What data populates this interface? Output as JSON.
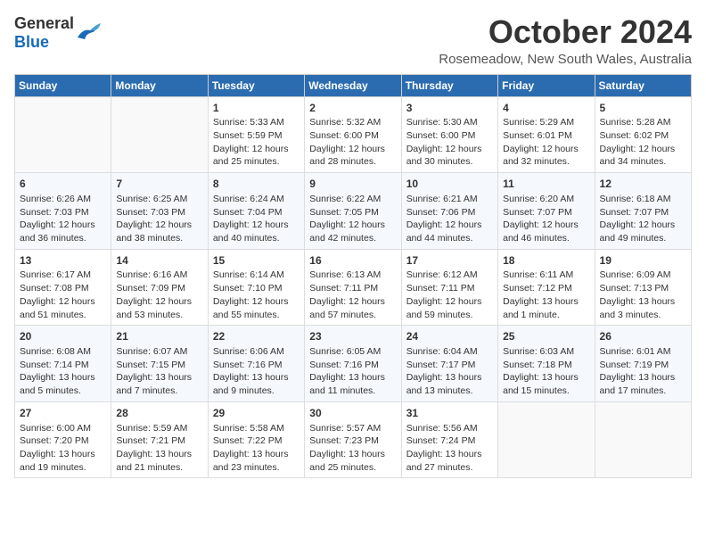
{
  "header": {
    "logo_general": "General",
    "logo_blue": "Blue",
    "month": "October 2024",
    "location": "Rosemeadow, New South Wales, Australia"
  },
  "days_of_week": [
    "Sunday",
    "Monday",
    "Tuesday",
    "Wednesday",
    "Thursday",
    "Friday",
    "Saturday"
  ],
  "weeks": [
    [
      {
        "day": "",
        "sunrise": "",
        "sunset": "",
        "daylight": ""
      },
      {
        "day": "",
        "sunrise": "",
        "sunset": "",
        "daylight": ""
      },
      {
        "day": "1",
        "sunrise": "Sunrise: 5:33 AM",
        "sunset": "Sunset: 5:59 PM",
        "daylight": "Daylight: 12 hours and 25 minutes."
      },
      {
        "day": "2",
        "sunrise": "Sunrise: 5:32 AM",
        "sunset": "Sunset: 6:00 PM",
        "daylight": "Daylight: 12 hours and 28 minutes."
      },
      {
        "day": "3",
        "sunrise": "Sunrise: 5:30 AM",
        "sunset": "Sunset: 6:00 PM",
        "daylight": "Daylight: 12 hours and 30 minutes."
      },
      {
        "day": "4",
        "sunrise": "Sunrise: 5:29 AM",
        "sunset": "Sunset: 6:01 PM",
        "daylight": "Daylight: 12 hours and 32 minutes."
      },
      {
        "day": "5",
        "sunrise": "Sunrise: 5:28 AM",
        "sunset": "Sunset: 6:02 PM",
        "daylight": "Daylight: 12 hours and 34 minutes."
      }
    ],
    [
      {
        "day": "6",
        "sunrise": "Sunrise: 6:26 AM",
        "sunset": "Sunset: 7:03 PM",
        "daylight": "Daylight: 12 hours and 36 minutes."
      },
      {
        "day": "7",
        "sunrise": "Sunrise: 6:25 AM",
        "sunset": "Sunset: 7:03 PM",
        "daylight": "Daylight: 12 hours and 38 minutes."
      },
      {
        "day": "8",
        "sunrise": "Sunrise: 6:24 AM",
        "sunset": "Sunset: 7:04 PM",
        "daylight": "Daylight: 12 hours and 40 minutes."
      },
      {
        "day": "9",
        "sunrise": "Sunrise: 6:22 AM",
        "sunset": "Sunset: 7:05 PM",
        "daylight": "Daylight: 12 hours and 42 minutes."
      },
      {
        "day": "10",
        "sunrise": "Sunrise: 6:21 AM",
        "sunset": "Sunset: 7:06 PM",
        "daylight": "Daylight: 12 hours and 44 minutes."
      },
      {
        "day": "11",
        "sunrise": "Sunrise: 6:20 AM",
        "sunset": "Sunset: 7:07 PM",
        "daylight": "Daylight: 12 hours and 46 minutes."
      },
      {
        "day": "12",
        "sunrise": "Sunrise: 6:18 AM",
        "sunset": "Sunset: 7:07 PM",
        "daylight": "Daylight: 12 hours and 49 minutes."
      }
    ],
    [
      {
        "day": "13",
        "sunrise": "Sunrise: 6:17 AM",
        "sunset": "Sunset: 7:08 PM",
        "daylight": "Daylight: 12 hours and 51 minutes."
      },
      {
        "day": "14",
        "sunrise": "Sunrise: 6:16 AM",
        "sunset": "Sunset: 7:09 PM",
        "daylight": "Daylight: 12 hours and 53 minutes."
      },
      {
        "day": "15",
        "sunrise": "Sunrise: 6:14 AM",
        "sunset": "Sunset: 7:10 PM",
        "daylight": "Daylight: 12 hours and 55 minutes."
      },
      {
        "day": "16",
        "sunrise": "Sunrise: 6:13 AM",
        "sunset": "Sunset: 7:11 PM",
        "daylight": "Daylight: 12 hours and 57 minutes."
      },
      {
        "day": "17",
        "sunrise": "Sunrise: 6:12 AM",
        "sunset": "Sunset: 7:11 PM",
        "daylight": "Daylight: 12 hours and 59 minutes."
      },
      {
        "day": "18",
        "sunrise": "Sunrise: 6:11 AM",
        "sunset": "Sunset: 7:12 PM",
        "daylight": "Daylight: 13 hours and 1 minute."
      },
      {
        "day": "19",
        "sunrise": "Sunrise: 6:09 AM",
        "sunset": "Sunset: 7:13 PM",
        "daylight": "Daylight: 13 hours and 3 minutes."
      }
    ],
    [
      {
        "day": "20",
        "sunrise": "Sunrise: 6:08 AM",
        "sunset": "Sunset: 7:14 PM",
        "daylight": "Daylight: 13 hours and 5 minutes."
      },
      {
        "day": "21",
        "sunrise": "Sunrise: 6:07 AM",
        "sunset": "Sunset: 7:15 PM",
        "daylight": "Daylight: 13 hours and 7 minutes."
      },
      {
        "day": "22",
        "sunrise": "Sunrise: 6:06 AM",
        "sunset": "Sunset: 7:16 PM",
        "daylight": "Daylight: 13 hours and 9 minutes."
      },
      {
        "day": "23",
        "sunrise": "Sunrise: 6:05 AM",
        "sunset": "Sunset: 7:16 PM",
        "daylight": "Daylight: 13 hours and 11 minutes."
      },
      {
        "day": "24",
        "sunrise": "Sunrise: 6:04 AM",
        "sunset": "Sunset: 7:17 PM",
        "daylight": "Daylight: 13 hours and 13 minutes."
      },
      {
        "day": "25",
        "sunrise": "Sunrise: 6:03 AM",
        "sunset": "Sunset: 7:18 PM",
        "daylight": "Daylight: 13 hours and 15 minutes."
      },
      {
        "day": "26",
        "sunrise": "Sunrise: 6:01 AM",
        "sunset": "Sunset: 7:19 PM",
        "daylight": "Daylight: 13 hours and 17 minutes."
      }
    ],
    [
      {
        "day": "27",
        "sunrise": "Sunrise: 6:00 AM",
        "sunset": "Sunset: 7:20 PM",
        "daylight": "Daylight: 13 hours and 19 minutes."
      },
      {
        "day": "28",
        "sunrise": "Sunrise: 5:59 AM",
        "sunset": "Sunset: 7:21 PM",
        "daylight": "Daylight: 13 hours and 21 minutes."
      },
      {
        "day": "29",
        "sunrise": "Sunrise: 5:58 AM",
        "sunset": "Sunset: 7:22 PM",
        "daylight": "Daylight: 13 hours and 23 minutes."
      },
      {
        "day": "30",
        "sunrise": "Sunrise: 5:57 AM",
        "sunset": "Sunset: 7:23 PM",
        "daylight": "Daylight: 13 hours and 25 minutes."
      },
      {
        "day": "31",
        "sunrise": "Sunrise: 5:56 AM",
        "sunset": "Sunset: 7:24 PM",
        "daylight": "Daylight: 13 hours and 27 minutes."
      },
      {
        "day": "",
        "sunrise": "",
        "sunset": "",
        "daylight": ""
      },
      {
        "day": "",
        "sunrise": "",
        "sunset": "",
        "daylight": ""
      }
    ]
  ]
}
